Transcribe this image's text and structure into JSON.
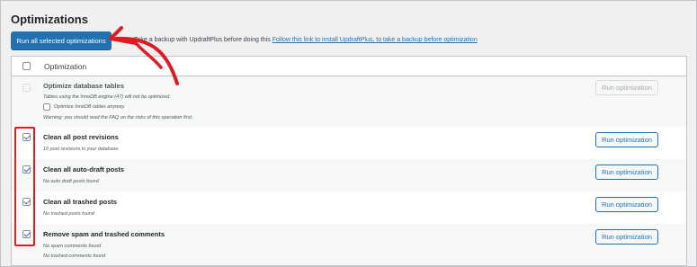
{
  "page": {
    "title": "Optimizations",
    "run_all_label": "Run all selected optimizations",
    "backup_text": "Take a backup with UpdraftPlus before doing this",
    "backup_link": "Follow this link to install UpdraftPlus, to take a backup before optimization"
  },
  "table": {
    "header_label": "Optimization",
    "rows": [
      {
        "title": "Optimize database tables",
        "note_1": "Tables using the InnoDB engine (47) will not be optimized.",
        "inline_checkbox_label": "Optimize InnoDB tables anyway.",
        "warning_link": "Warning: you should read the FAQ on the risks of this operation first.",
        "button": "Run optimization",
        "checked": false,
        "disabled": true
      },
      {
        "title": "Clean all post revisions",
        "note_1": "16 post revisions in your database",
        "button": "Run optimization",
        "checked": true
      },
      {
        "title": "Clean all auto-draft posts",
        "note_1": "No auto draft posts found",
        "button": "Run optimization",
        "checked": true
      },
      {
        "title": "Clean all trashed posts",
        "note_1": "No trashed posts found",
        "button": "Run optimization",
        "checked": true
      },
      {
        "title": "Remove spam and trashed comments",
        "note_1": "No spam comments found",
        "note_2": "No trashed comments found",
        "button": "Run optimization",
        "checked": true
      }
    ]
  },
  "colors": {
    "accent": "#2271b1",
    "annotation": "#e01b24"
  },
  "annotations": {
    "arrow": "red hand-drawn arrow pointing to run-all button",
    "box": "red rectangle around checked checkboxes"
  }
}
